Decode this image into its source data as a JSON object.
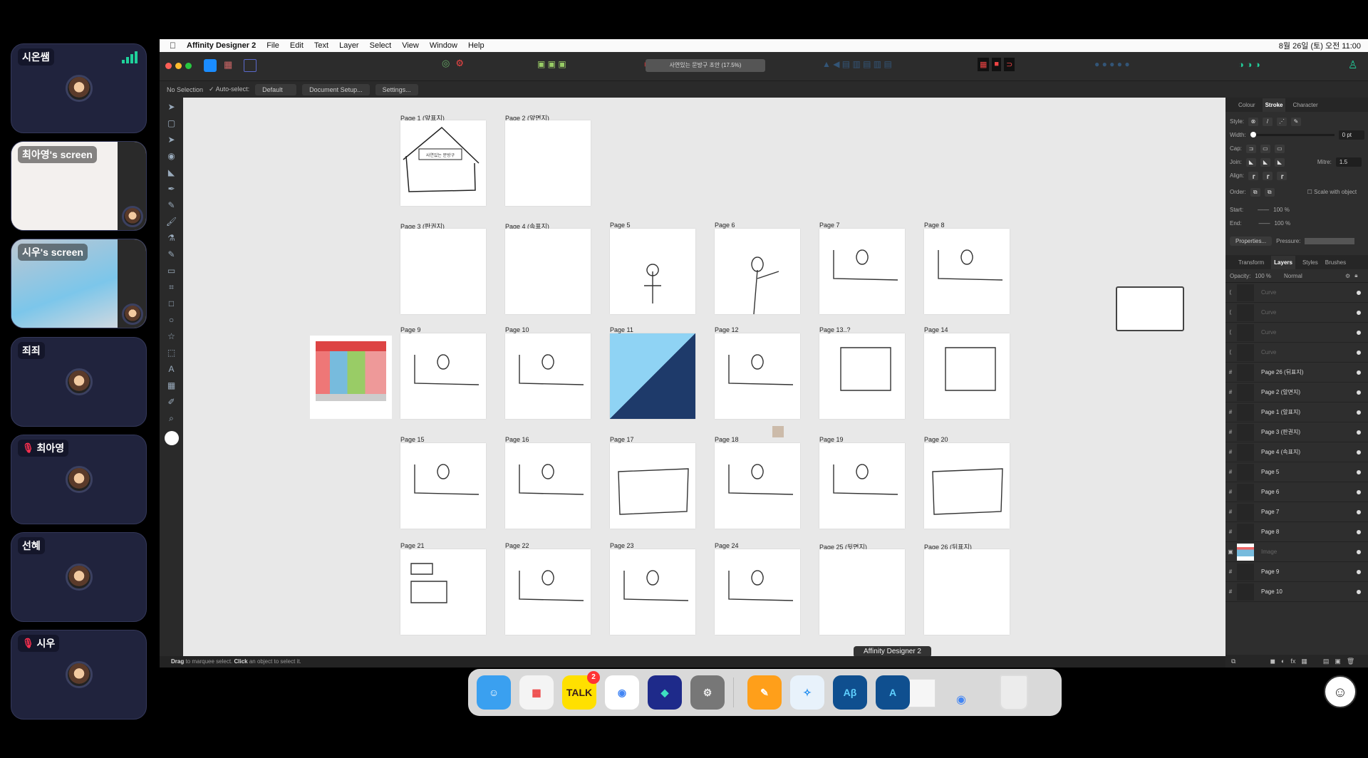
{
  "participants": [
    {
      "name": "시온쌤",
      "muted": false,
      "signal": true
    },
    {
      "name": "최아영's screen",
      "screen": true
    },
    {
      "name": "시우's screen",
      "screen": true
    },
    {
      "name": "죄죄",
      "muted": false
    },
    {
      "name": "최아영",
      "muted": true
    },
    {
      "name": "선혜",
      "muted": false
    },
    {
      "name": "시우",
      "muted": true
    }
  ],
  "menubar": {
    "app": "Affinity Designer 2",
    "items": [
      "File",
      "Edit",
      "Text",
      "Layer",
      "Select",
      "View",
      "Window",
      "Help"
    ],
    "clock": "8월 26일 (토) 오전 11:00"
  },
  "toolbar": {
    "doc_title": "사연있는 문방구 초안 (17.5%)"
  },
  "context": {
    "selection": "No Selection",
    "auto_select": "Auto-select:",
    "mode": "Default",
    "doc_setup": "Document Setup...",
    "settings": "Settings..."
  },
  "pages": [
    [
      "Page 1 (앞표지)",
      "Page 2 (앞면지)"
    ],
    [
      "Page 3 (판권지)",
      "Page 4 (속표지)",
      "Page 5",
      "Page 6",
      "Page 7",
      "Page 8"
    ],
    [
      "Page 9",
      "Page 10",
      "Page 11",
      "Page 12",
      "Page 13..?",
      "Page 14"
    ],
    [
      "Page 15",
      "Page 16",
      "Page 17",
      "Page 18",
      "Page 19",
      "Page 20"
    ],
    [
      "Page 21",
      "Page 22",
      "Page 23",
      "Page 24",
      "Page 25 (뒷면지)",
      "Page 26 (뒤표지)"
    ]
  ],
  "cover_text": "사연있는 문방구",
  "status": {
    "drag": "Drag",
    "t1": " to marquee select. ",
    "click": "Click",
    "t2": " an object to select it."
  },
  "tooltip": "Affinity Designer 2",
  "stroke_panel": {
    "tabs": [
      "Colour",
      "Stroke",
      "Character"
    ],
    "style": "Style:",
    "width": "Width:",
    "width_val": "0 pt",
    "cap": "Cap:",
    "join": "Join:",
    "mitre": "Mitre:",
    "mitre_val": "1.5",
    "align": "Align:",
    "order": "Order:",
    "scale": "Scale with object",
    "start": "Start:",
    "end": "End:",
    "start_pct": "100 %",
    "end_pct": "100 %",
    "properties": "Properties...",
    "pressure": "Pressure:"
  },
  "layers_panel": {
    "tabs": [
      "Transform",
      "Layers",
      "Styles",
      "Brushes"
    ],
    "opacity": "Opacity:",
    "opacity_val": "100 %",
    "blend": "Normal",
    "items": [
      {
        "name": "Curve",
        "type": "curve"
      },
      {
        "name": "Curve",
        "type": "curve"
      },
      {
        "name": "Curve",
        "type": "curve"
      },
      {
        "name": "Curve",
        "type": "curve"
      },
      {
        "name": "Page 26 (뒤표지)",
        "type": "artboard"
      },
      {
        "name": "Page 2 (앞면지)",
        "type": "artboard"
      },
      {
        "name": "Page 1 (앞표지)",
        "type": "artboard"
      },
      {
        "name": "Page 3 (판권지)",
        "type": "artboard"
      },
      {
        "name": "Page 4 (속표지)",
        "type": "artboard"
      },
      {
        "name": "Page 5",
        "type": "artboard"
      },
      {
        "name": "Page 6",
        "type": "artboard"
      },
      {
        "name": "Page 7",
        "type": "artboard"
      },
      {
        "name": "Page 8",
        "type": "artboard"
      },
      {
        "name": "Image",
        "type": "image"
      },
      {
        "name": "Page 9",
        "type": "artboard"
      },
      {
        "name": "Page 10",
        "type": "artboard"
      }
    ]
  },
  "dock": [
    {
      "name": "Finder",
      "label": "☺",
      "bg": "#3aa0f0",
      "fg": "#fff"
    },
    {
      "name": "Launchpad",
      "label": "▦",
      "bg": "#f4f4f4",
      "fg": "#e44"
    },
    {
      "name": "KakaoTalk",
      "label": "TALK",
      "bg": "#ffe000",
      "fg": "#3a1d1d",
      "badge": "2"
    },
    {
      "name": "Chrome",
      "label": "◉",
      "bg": "#fff",
      "fg": "#4285f4"
    },
    {
      "name": "Whale",
      "label": "◆",
      "bg": "#1e2a8a",
      "fg": "#3de0c0"
    },
    {
      "name": "System Settings",
      "label": "⚙",
      "bg": "#777",
      "fg": "#eee"
    },
    {
      "name": "Pages",
      "label": "✎",
      "bg": "#ff9f1a",
      "fg": "#fff"
    },
    {
      "name": "Safari",
      "label": "✧",
      "bg": "#e8f2fb",
      "fg": "#1a8af0"
    },
    {
      "name": "Affinity Designer Beta",
      "label": "Aβ",
      "bg": "#0f4f8f",
      "fg": "#5fd0ff"
    },
    {
      "name": "Affinity Designer 2",
      "label": "A",
      "bg": "#0f4f8f",
      "fg": "#5fd0ff"
    }
  ]
}
